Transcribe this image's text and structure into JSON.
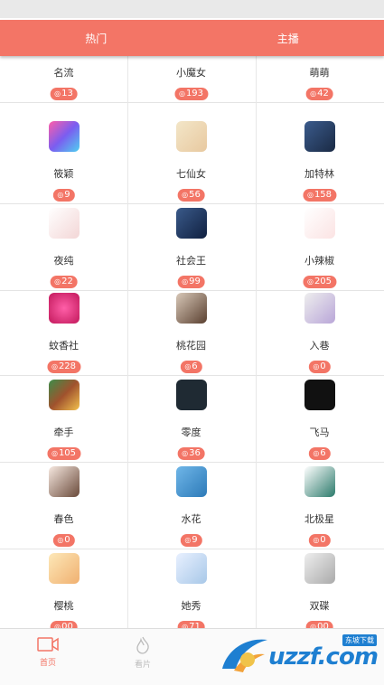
{
  "tabs": [
    {
      "label": "热门",
      "active": true
    },
    {
      "label": "主播",
      "active": false
    }
  ],
  "rows": [
    [
      {
        "name": "名流",
        "count": "13"
      },
      {
        "name": "小魔女",
        "count": "193"
      },
      {
        "name": "萌萌",
        "count": "42"
      }
    ],
    [
      {
        "name": "筱颖",
        "count": "9"
      },
      {
        "name": "七仙女",
        "count": "56"
      },
      {
        "name": "加特林",
        "count": "158"
      }
    ],
    [
      {
        "name": "夜纯",
        "count": "22"
      },
      {
        "name": "社会王",
        "count": "99"
      },
      {
        "name": "小辣椒",
        "count": "205"
      }
    ],
    [
      {
        "name": "蚊香社",
        "count": "228"
      },
      {
        "name": "桃花园",
        "count": "6"
      },
      {
        "name": "入巷",
        "count": "0"
      }
    ],
    [
      {
        "name": "牵手",
        "count": "105"
      },
      {
        "name": "零度",
        "count": "36"
      },
      {
        "name": "飞马",
        "count": "6"
      }
    ],
    [
      {
        "name": "春色",
        "count": "0"
      },
      {
        "name": "水花",
        "count": "9"
      },
      {
        "name": "北极星",
        "count": "0"
      }
    ],
    [
      {
        "name": "樱桃",
        "count": "00"
      },
      {
        "name": "她秀",
        "count": "71"
      },
      {
        "name": "双碟",
        "count": "00"
      }
    ]
  ],
  "bottom_nav": [
    {
      "label": "首页",
      "icon": "video-camera-icon",
      "active": true
    },
    {
      "label": "看片",
      "icon": "flame-icon",
      "active": false
    }
  ],
  "watermark": {
    "text": "uzzf.com",
    "stamp": "东坡下载"
  },
  "colors": {
    "accent": "#f37566",
    "text": "#333333",
    "nav_inactive": "#bbbbbb"
  }
}
